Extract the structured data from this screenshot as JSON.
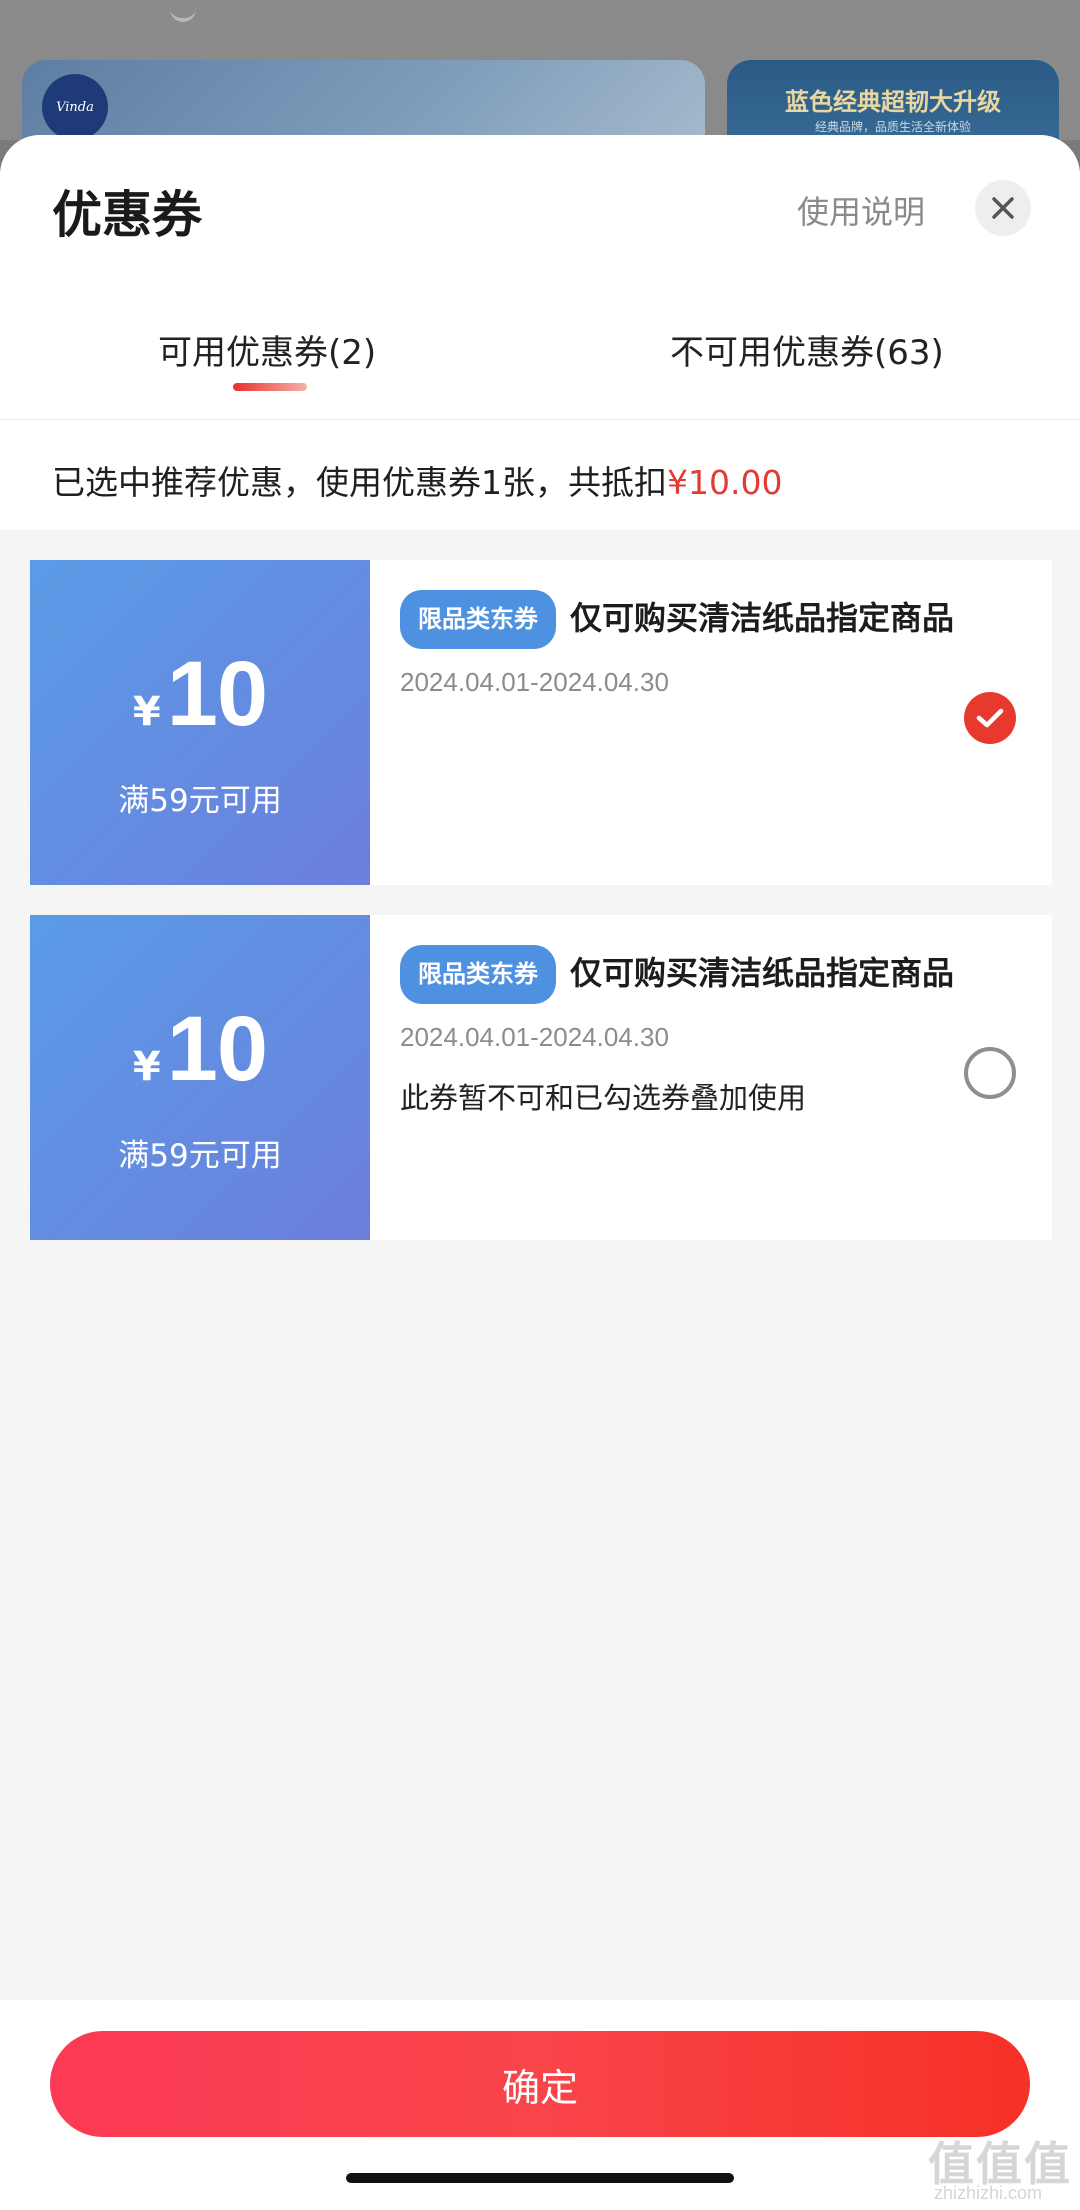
{
  "background": {
    "logo_text": "Vinda",
    "banner_title": "蓝色经典超韧大升级",
    "banner_subtitle": "经典品牌，品质生活全新体验"
  },
  "sheet": {
    "title": "优惠券",
    "help_link": "使用说明",
    "close_icon": "close-icon"
  },
  "tabs": [
    {
      "label": "可用优惠券(2)",
      "active": true
    },
    {
      "label": "不可用优惠券(63)",
      "active": false
    }
  ],
  "summary": {
    "text": "已选中推荐优惠，使用优惠券1张，共抵扣",
    "amount": "¥10.00"
  },
  "coupons": [
    {
      "currency": "¥",
      "amount": "10",
      "threshold": "满59元可用",
      "badge": "限品类东券",
      "description": "仅可购买清洁纸品指定商品",
      "validity": "2024.04.01-2024.04.30",
      "note": "",
      "selected": true
    },
    {
      "currency": "¥",
      "amount": "10",
      "threshold": "满59元可用",
      "badge": "限品类东券",
      "description": "仅可购买清洁纸品指定商品",
      "validity": "2024.04.01-2024.04.30",
      "note": "此券暂不可和已勾选券叠加使用",
      "selected": false
    }
  ],
  "footer": {
    "confirm_label": "确定"
  },
  "watermark": {
    "text": "值值值",
    "sub": "zhizhizhi.com"
  },
  "colors": {
    "accent_red": "#e8392f",
    "coupon_blue": "#5a9be6",
    "badge_blue": "#4e91e1"
  }
}
